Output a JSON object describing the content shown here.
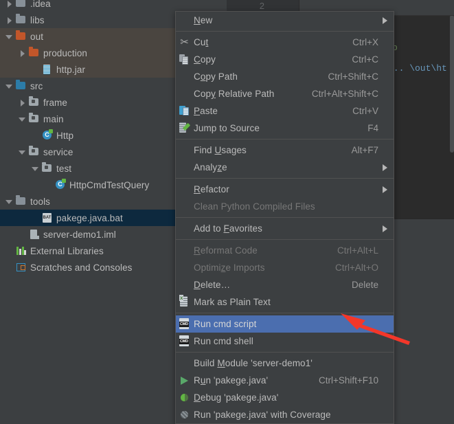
{
  "app": {
    "theme_bg": "#3c3f41",
    "editor_bg": "#2b2b2b",
    "accent_selection": "#4b6eaf",
    "tree_selection": "#0d293e",
    "annotation_color": "#f3372a"
  },
  "editor": {
    "line_number": "2",
    "code_fragment_keyword": "p",
    "code_fragment_path": "\\.. \\out\\ht"
  },
  "project_tree": {
    "items": [
      {
        "label": ".idea",
        "icon": "folder-gray-icon",
        "toggle": "chevron-right-icon",
        "indent": 0,
        "state": "partial-top"
      },
      {
        "label": "libs",
        "icon": "folder-gray-icon",
        "toggle": "chevron-right-icon",
        "indent": 0,
        "state": "normal"
      },
      {
        "label": "out",
        "icon": "folder-orange-icon",
        "toggle": "chevron-down-icon",
        "indent": 0,
        "state": "band"
      },
      {
        "label": "production",
        "icon": "folder-orange-icon",
        "toggle": "chevron-right-icon",
        "indent": 1,
        "state": "band"
      },
      {
        "label": "http.jar",
        "icon": "jar-file-icon",
        "toggle": "none",
        "indent": 2,
        "state": "band"
      },
      {
        "label": "src",
        "icon": "folder-blue-icon",
        "toggle": "chevron-down-icon",
        "indent": 0,
        "state": "normal"
      },
      {
        "label": "frame",
        "icon": "package-icon",
        "toggle": "chevron-right-icon",
        "indent": 1,
        "state": "normal"
      },
      {
        "label": "main",
        "icon": "package-icon",
        "toggle": "chevron-down-icon",
        "indent": 1,
        "state": "normal"
      },
      {
        "label": "Http",
        "icon": "java-class-icon",
        "toggle": "none",
        "indent": 2,
        "state": "normal"
      },
      {
        "label": "service",
        "icon": "package-icon",
        "toggle": "chevron-down-icon",
        "indent": 1,
        "state": "normal"
      },
      {
        "label": "test",
        "icon": "package-icon",
        "toggle": "chevron-down-icon",
        "indent": 2,
        "state": "normal"
      },
      {
        "label": "HttpCmdTestQuery",
        "icon": "java-class-icon",
        "toggle": "none",
        "indent": 3,
        "state": "normal"
      },
      {
        "label": "tools",
        "icon": "folder-gray-icon",
        "toggle": "chevron-down-icon",
        "indent": 0,
        "state": "normal"
      },
      {
        "label": "pakege.java.bat",
        "icon": "bat-file-icon",
        "toggle": "none",
        "indent": 2,
        "state": "selected"
      },
      {
        "label": "server-demo1.iml",
        "icon": "iml-file-icon",
        "toggle": "none",
        "indent": 1,
        "state": "normal"
      },
      {
        "label": "External Libraries",
        "icon": "external-libraries-icon",
        "toggle": "none",
        "indent": 0,
        "state": "normal"
      },
      {
        "label": "Scratches and Consoles",
        "icon": "scratches-icon",
        "toggle": "none",
        "indent": 0,
        "state": "normal"
      }
    ]
  },
  "context_menu": {
    "items": [
      {
        "label": "New",
        "mnemonic": "N",
        "shortcut": "",
        "icon": "",
        "submenu": true,
        "disabled": false,
        "selected": false,
        "separator_after": true
      },
      {
        "label": "Cut",
        "mnemonic": "t",
        "shortcut": "Ctrl+X",
        "icon": "scissors-icon",
        "submenu": false,
        "disabled": false,
        "selected": false,
        "separator_after": false
      },
      {
        "label": "Copy",
        "mnemonic": "C",
        "shortcut": "Ctrl+C",
        "icon": "copy-icon",
        "submenu": false,
        "disabled": false,
        "selected": false,
        "separator_after": false
      },
      {
        "label": "Copy Path",
        "mnemonic": "o",
        "shortcut": "Ctrl+Shift+C",
        "icon": "",
        "submenu": false,
        "disabled": false,
        "selected": false,
        "separator_after": false
      },
      {
        "label": "Copy Relative Path",
        "mnemonic": "y",
        "shortcut": "Ctrl+Alt+Shift+C",
        "icon": "",
        "submenu": false,
        "disabled": false,
        "selected": false,
        "separator_after": false
      },
      {
        "label": "Paste",
        "mnemonic": "P",
        "shortcut": "Ctrl+V",
        "icon": "paste-icon",
        "submenu": false,
        "disabled": false,
        "selected": false,
        "separator_after": false
      },
      {
        "label": "Jump to Source",
        "mnemonic": "",
        "shortcut": "F4",
        "icon": "jump-to-source-icon",
        "submenu": false,
        "disabled": false,
        "selected": false,
        "separator_after": true
      },
      {
        "label": "Find Usages",
        "mnemonic": "U",
        "shortcut": "Alt+F7",
        "icon": "",
        "submenu": false,
        "disabled": false,
        "selected": false,
        "separator_after": false
      },
      {
        "label": "Analyze",
        "mnemonic": "z",
        "shortcut": "",
        "icon": "",
        "submenu": true,
        "disabled": false,
        "selected": false,
        "separator_after": true
      },
      {
        "label": "Refactor",
        "mnemonic": "R",
        "shortcut": "",
        "icon": "",
        "submenu": true,
        "disabled": false,
        "selected": false,
        "separator_after": false
      },
      {
        "label": "Clean Python Compiled Files",
        "mnemonic": "",
        "shortcut": "",
        "icon": "",
        "submenu": false,
        "disabled": true,
        "selected": false,
        "separator_after": true
      },
      {
        "label": "Add to Favorites",
        "mnemonic": "F",
        "shortcut": "",
        "icon": "",
        "submenu": true,
        "disabled": false,
        "selected": false,
        "separator_after": true
      },
      {
        "label": "Reformat Code",
        "mnemonic": "R",
        "shortcut": "Ctrl+Alt+L",
        "icon": "",
        "submenu": false,
        "disabled": true,
        "selected": false,
        "separator_after": false
      },
      {
        "label": "Optimize Imports",
        "mnemonic": "z",
        "shortcut": "Ctrl+Alt+O",
        "icon": "",
        "submenu": false,
        "disabled": true,
        "selected": false,
        "separator_after": false
      },
      {
        "label": "Delete…",
        "mnemonic": "D",
        "shortcut": "Delete",
        "icon": "",
        "submenu": false,
        "disabled": false,
        "selected": false,
        "separator_after": false
      },
      {
        "label": "Mark as Plain Text",
        "mnemonic": "",
        "shortcut": "",
        "icon": "plain-text-icon",
        "submenu": false,
        "disabled": false,
        "selected": false,
        "separator_after": true
      },
      {
        "label": "Run cmd script",
        "mnemonic": "",
        "shortcut": "",
        "icon": "cmd-icon",
        "submenu": false,
        "disabled": false,
        "selected": true,
        "separator_after": false
      },
      {
        "label": "Run cmd shell",
        "mnemonic": "",
        "shortcut": "",
        "icon": "cmd-icon",
        "submenu": false,
        "disabled": false,
        "selected": false,
        "separator_after": true
      },
      {
        "label": "Build Module 'server-demo1'",
        "mnemonic": "M",
        "shortcut": "",
        "icon": "",
        "submenu": false,
        "disabled": false,
        "selected": false,
        "separator_after": false
      },
      {
        "label": "Run 'pakege.java'",
        "mnemonic": "u",
        "shortcut": "Ctrl+Shift+F10",
        "icon": "run-icon",
        "submenu": false,
        "disabled": false,
        "selected": false,
        "separator_after": false
      },
      {
        "label": "Debug 'pakege.java'",
        "mnemonic": "D",
        "shortcut": "",
        "icon": "debug-icon",
        "submenu": false,
        "disabled": false,
        "selected": false,
        "separator_after": false
      },
      {
        "label": "Run 'pakege.java' with Coverage",
        "mnemonic": "",
        "shortcut": "",
        "icon": "coverage-icon",
        "submenu": false,
        "disabled": false,
        "selected": false,
        "separator_after": false
      }
    ]
  },
  "annotation": {
    "type": "red-arrow",
    "points_to": "Run cmd script"
  }
}
